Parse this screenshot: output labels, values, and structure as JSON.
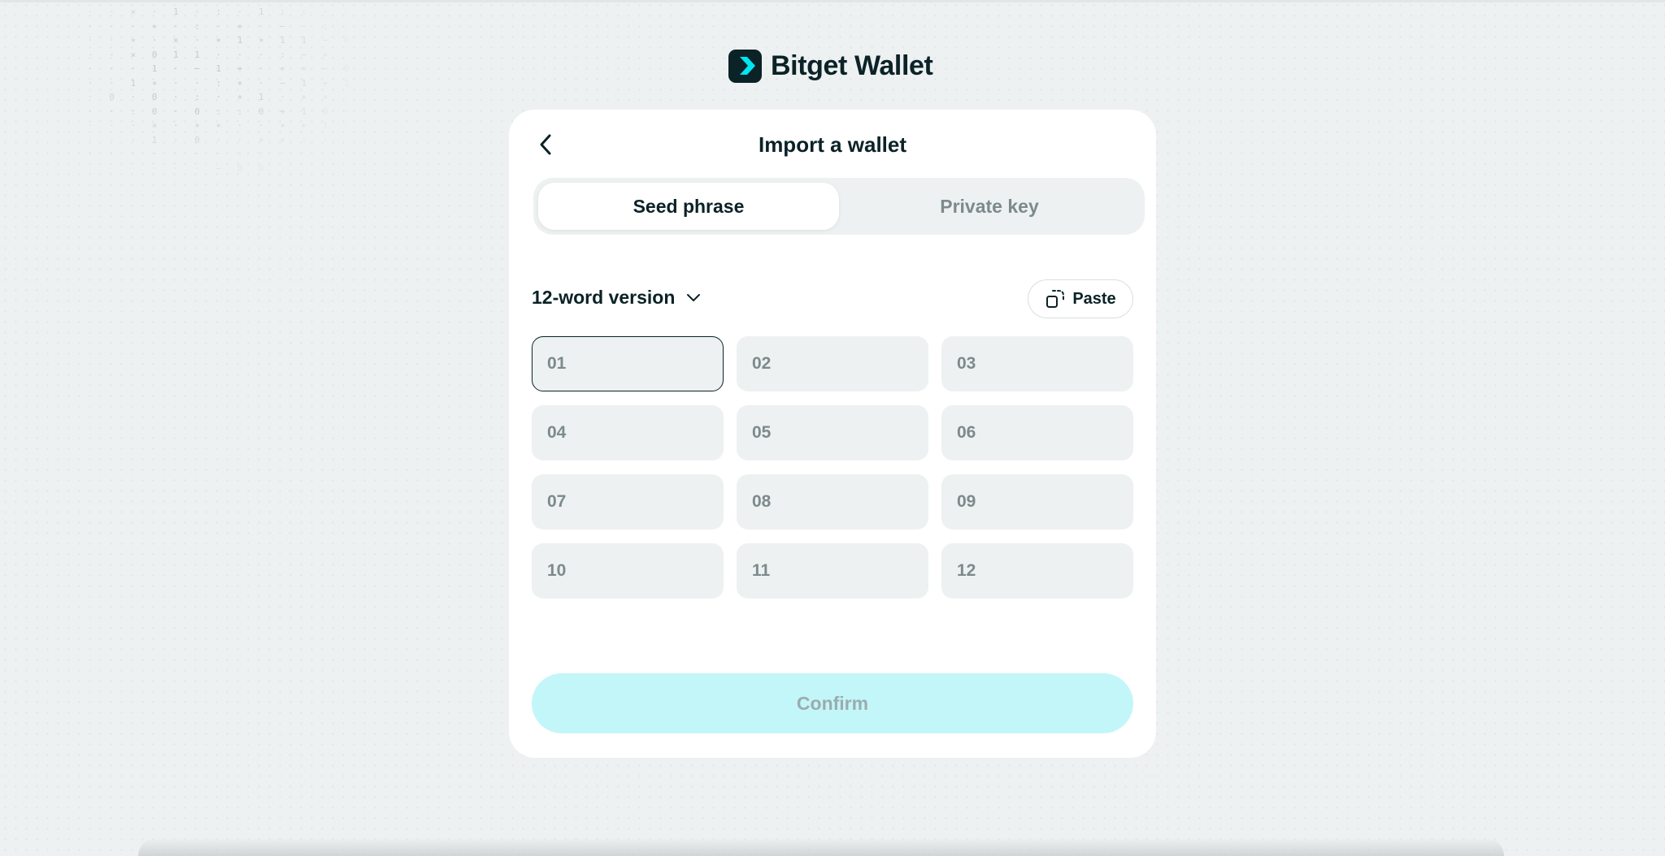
{
  "brand": {
    "name": "Bitget Wallet",
    "mark_bg": "#0b2227",
    "mark_arrow": "#00e5f0"
  },
  "background_pattern": {
    "icon": "matrix-glyph-pattern",
    "lines": [
      "· · × · 1 · : · 1 : : · ∗ 1 · 1 0 · · · ·",
      "· · · ∗ · : · + · − · : · + ∗ 0 · ∗ · 0 1 · · ·",
      "· · ∗ · × · ∗ 1 ∗ 1 1 − 0 · 1 − : + : · :",
      "· · × 0 1 1 · · · : − ∗ · · · − · · : · · ·",
      "· · · 1 · − 1 + · ∗ ∗ − 0 + 1 1 + · · 0 · ·",
      "· · 1 ∗ · · : ∗ · − 1 + 1 + ∗ + · : : ∗ ·",
      "· 0 · 0 · : · ∗ 1 · ∗ ∗ · ∗ · : · ∗ · 1 ·",
      "· · : 0 · 0 : : 0 + 1 0 + 1 0 ∗ 1 · · · ·",
      "· · · × · ∗ ∗ · · ∗ ∗ 1 ∗ 0 1 · · · 0 · ·",
      "· · · 1 · 0 · · ∗ ∗ : ∗ ∗ · · · · · ·",
      "· · · · · · · : : · · · ∗ · ∗ · ·",
      "· · · · · · − 0 0 · · 0 · · · · ·",
      "· · · · · · · · · · 0 · ·"
    ]
  },
  "card": {
    "title": "Import a wallet",
    "tabs": [
      {
        "label": "Seed phrase",
        "active": true
      },
      {
        "label": "Private key",
        "active": false
      }
    ],
    "version_label": "12-word version",
    "paste_label": "Paste",
    "words": [
      {
        "placeholder": "01",
        "value": ""
      },
      {
        "placeholder": "02",
        "value": ""
      },
      {
        "placeholder": "03",
        "value": ""
      },
      {
        "placeholder": "04",
        "value": ""
      },
      {
        "placeholder": "05",
        "value": ""
      },
      {
        "placeholder": "06",
        "value": ""
      },
      {
        "placeholder": "07",
        "value": ""
      },
      {
        "placeholder": "08",
        "value": ""
      },
      {
        "placeholder": "09",
        "value": ""
      },
      {
        "placeholder": "10",
        "value": ""
      },
      {
        "placeholder": "11",
        "value": ""
      },
      {
        "placeholder": "12",
        "value": ""
      }
    ],
    "focused_word_index": 0,
    "confirm_label": "Confirm",
    "confirm_disabled": true,
    "confirm_color": "#c3f6f9"
  },
  "icons": {
    "back": "chevron-left-icon",
    "version_toggle": "chevron-down-icon",
    "paste": "paste-icon",
    "logo": "bitget-logo-icon"
  }
}
